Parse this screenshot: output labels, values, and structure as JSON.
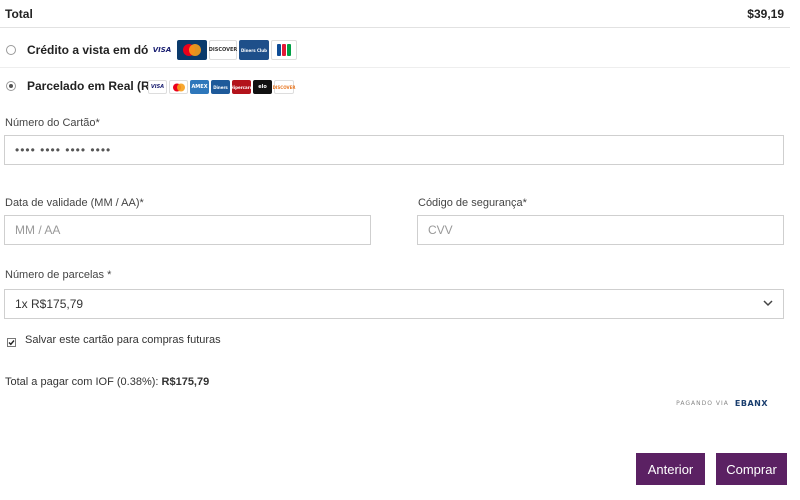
{
  "summary": {
    "total_label": "Total",
    "total_value": "$39,19"
  },
  "payment_options": [
    {
      "label": "Crédito a vista em dólar.",
      "selected": false,
      "brands": [
        "VISA",
        "mastercard",
        "DISCOVER",
        "Diners Club",
        "JCB"
      ]
    },
    {
      "label": "Parcelado em Real (R$)",
      "selected": true,
      "brands": [
        "VISA",
        "mastercard",
        "AMEX",
        "Diners",
        "Hipercard",
        "elo",
        "DISCOVER"
      ]
    }
  ],
  "card_number": {
    "label": "Número do Cartão*",
    "value": "•••• •••• •••• ••••"
  },
  "expiry": {
    "label": "Data de validade (MM / AA)*",
    "placeholder": "MM / AA"
  },
  "cvv": {
    "label": "Código de segurança*",
    "placeholder": "CVV"
  },
  "installments": {
    "label": "Número de parcelas *",
    "selected": "1x R$175,79"
  },
  "save_card": {
    "label": "Salvar este cartão para compras futuras",
    "checked": true
  },
  "iof": {
    "prefix": "Total a pagar com IOF (0.38%):",
    "amount": "R$175,79"
  },
  "powered_by": {
    "label": "PAGANDO VIA",
    "brand": "EBANX"
  },
  "buttons": {
    "previous": "Anterior",
    "buy": "Comprar"
  },
  "colors": {
    "button_bg": "#5b2163",
    "button_text": "#ffffff",
    "border": "#cfcfcf"
  }
}
